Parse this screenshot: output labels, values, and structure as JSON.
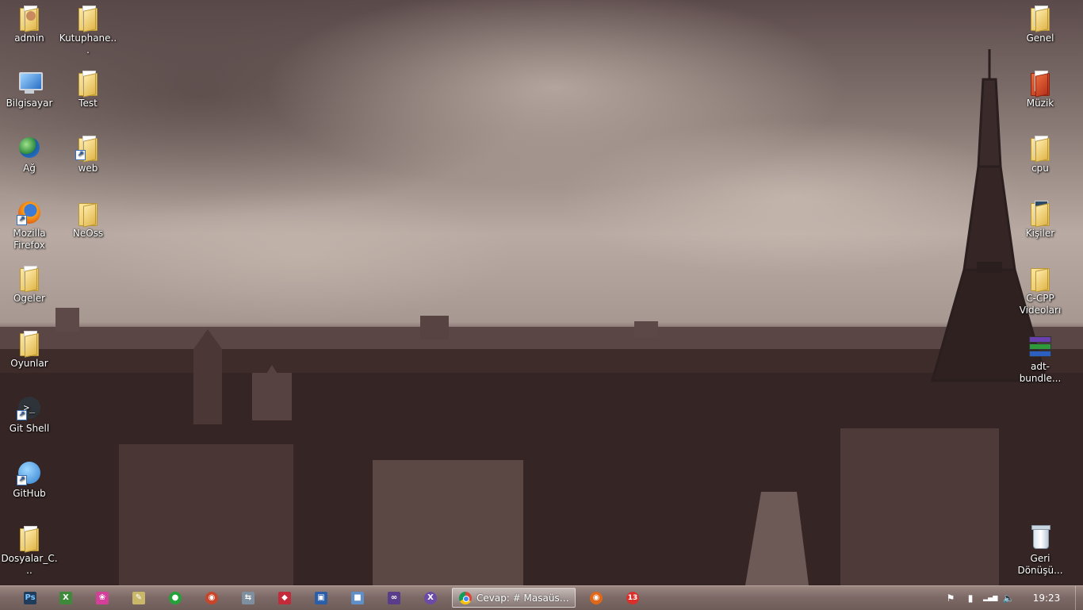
{
  "desktop": {
    "left_column": [
      {
        "label": "admin",
        "icon": "user-folder-icon"
      },
      {
        "label": "Bilgisayar",
        "icon": "computer-icon"
      },
      {
        "label": "Ağ",
        "icon": "network-icon"
      },
      {
        "label": "Mozilla Firefox",
        "icon": "firefox-icon"
      },
      {
        "label": "Ogeler",
        "icon": "folder-icon"
      },
      {
        "label": "Oyunlar",
        "icon": "folder-icon"
      },
      {
        "label": "Git Shell",
        "icon": "git-shell-icon"
      },
      {
        "label": "GitHub",
        "icon": "github-icon"
      },
      {
        "label": "Dosyalar_C...",
        "icon": "folder-icon"
      }
    ],
    "second_column": [
      {
        "label": "Kutuphane...",
        "icon": "folder-icon"
      },
      {
        "label": "Test",
        "icon": "folder-icon"
      },
      {
        "label": "web",
        "icon": "folder-shortcut-icon"
      },
      {
        "label": "NeOss",
        "icon": "folder-icon"
      }
    ],
    "right_column": [
      {
        "label": "Genel",
        "icon": "folder-icon"
      },
      {
        "label": "Müzik",
        "icon": "music-folder-icon"
      },
      {
        "label": "cpu",
        "icon": "folder-icon"
      },
      {
        "label": "Kişiler",
        "icon": "contacts-folder-icon"
      },
      {
        "label": "C-CPP Videoları",
        "icon": "folder-icon"
      },
      {
        "label": "adt-bundle...",
        "icon": "winrar-archive-icon"
      },
      {
        "label": "Geri Dönüşü...",
        "icon": "recycle-bin-icon"
      }
    ]
  },
  "taskbar": {
    "pinned": [
      {
        "name": "photoshop",
        "glyph": "Ps",
        "color": "#1f3c5a"
      },
      {
        "name": "excel-like-app",
        "glyph": "X",
        "color": "#3e8a3a"
      },
      {
        "name": "pink-app",
        "glyph": "❀",
        "color": "#d43f9a"
      },
      {
        "name": "notepad",
        "glyph": "✎",
        "color": "#c9b86a"
      },
      {
        "name": "green-ball-app",
        "glyph": "●",
        "color": "#23a23a"
      },
      {
        "name": "firefox-aurora",
        "glyph": "◉",
        "color": "#c8452a"
      },
      {
        "name": "network-tool",
        "glyph": "⇆",
        "color": "#7e8fa0"
      },
      {
        "name": "red-gem-app",
        "glyph": "◆",
        "color": "#c32a3a"
      },
      {
        "name": "screen-app",
        "glyph": "▣",
        "color": "#2b5ea8"
      },
      {
        "name": "cube-app",
        "glyph": "■",
        "color": "#5f8fc8"
      },
      {
        "name": "visual-studio",
        "glyph": "∞",
        "color": "#5a3d8a"
      },
      {
        "name": "xamarin-app",
        "glyph": "X",
        "color": "#6c4aa8"
      }
    ],
    "active_window": {
      "title": "Cevap: # Masaüstü S..."
    },
    "after_pinned": [
      {
        "name": "firefox",
        "glyph": "◉",
        "color": "#e0661a"
      },
      {
        "name": "badge-app",
        "glyph": "13",
        "color": "#d9302c"
      }
    ],
    "tray": {
      "flag": "⚑",
      "power": "▮",
      "signal": "▂▄▆",
      "volume": "🔈",
      "time": "19:23"
    }
  }
}
